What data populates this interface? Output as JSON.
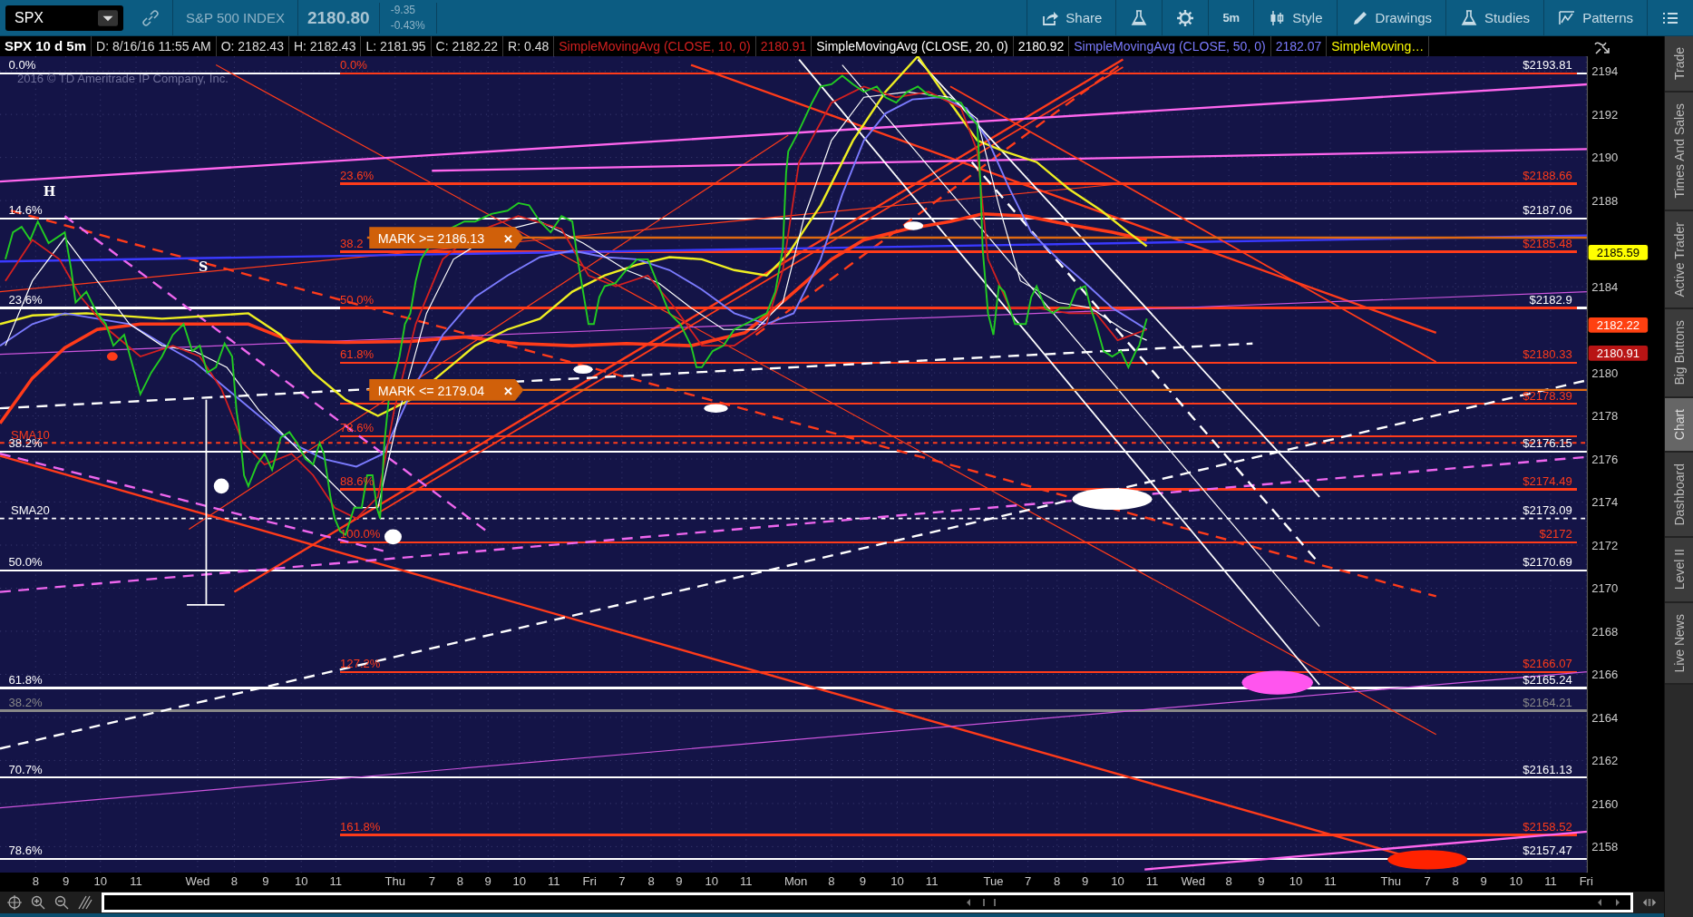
{
  "toolbar": {
    "symbol": "SPX",
    "description": "S&P 500 INDEX",
    "last": "2180.80",
    "change": "-9.35",
    "change_percent": "-0.43%",
    "buttons": [
      {
        "kind": "share",
        "label": "Share"
      },
      {
        "kind": "flask"
      },
      {
        "kind": "gear"
      },
      {
        "kind": "text",
        "label": "5m"
      },
      {
        "kind": "candles",
        "label": "Style"
      },
      {
        "kind": "pencil",
        "label": "Drawings"
      },
      {
        "kind": "flask",
        "label": "Studies"
      },
      {
        "kind": "pattern",
        "label": "Patterns"
      },
      {
        "kind": "list"
      }
    ]
  },
  "info_bar": {
    "title": "SPX 10 d 5m",
    "fields": [
      "D: 8/16/16 11:55 AM",
      "O: 2182.43",
      "H: 2182.43",
      "L: 2181.95",
      "C: 2182.22",
      "R: 0.48"
    ],
    "studies": [
      {
        "name": "SimpleMovingAvg (CLOSE, 10, 0)",
        "value": "2180.91"
      },
      {
        "name": "SimpleMovingAvg (CLOSE, 20, 0)",
        "value": "2180.92"
      },
      {
        "name": "SimpleMovingAvg (CLOSE, 50, 0)",
        "value": "2182.07"
      },
      {
        "name": "SimpleMoving…"
      }
    ]
  },
  "chart": {
    "copyright": "2016 © TD Ameritrade IP Company, Inc.",
    "levels": [
      {
        "kind": "retracement",
        "left_label": "0.0%",
        "price_label": "$2193.81",
        "color": "#ffffff"
      },
      {
        "kind": "extension",
        "left_label": "0.0%",
        "color": "#ff3b1a"
      },
      {
        "kind": "extension",
        "left_label": "23.6%",
        "price_label": "$2188.66",
        "color": "#ff3b1a"
      },
      {
        "kind": "retracement",
        "left_label": "14.6%",
        "price_label": "$2187.06",
        "color": "#ffffff"
      },
      {
        "kind": "extension",
        "left_label": "38.2",
        "price_label": "$2185.48",
        "color": "#ff3b1a"
      },
      {
        "kind": "retracement",
        "left_label": "23.6%",
        "price_label": "$2182.9",
        "color": "#ffffff"
      },
      {
        "kind": "extension",
        "left_label": "50.0%",
        "color": "#ff3b1a"
      },
      {
        "kind": "extension",
        "left_label": "61.8%",
        "price_label": "$2180.33",
        "color": "#ff3b1a"
      },
      {
        "kind": "extension",
        "price_label": "$2178.39",
        "color": "#ff3b1a"
      },
      {
        "kind": "extension",
        "left_label": "78.6%",
        "color": "#ff3b1a"
      },
      {
        "kind": "sma",
        "left_label": "SMA10",
        "color": "#ff3b1a"
      },
      {
        "kind": "retracement",
        "left_label": "38.2%",
        "price_label": "$2176.15",
        "color": "#ffffff"
      },
      {
        "kind": "extension",
        "left_label": "88.6%",
        "price_label": "$2174.49",
        "color": "#ff3b1a"
      },
      {
        "kind": "sma",
        "left_label": "SMA20",
        "price_label": "$2173.09",
        "color": "#ffffff"
      },
      {
        "kind": "extension",
        "left_label": "100.0%",
        "price_label": "$2172",
        "color": "#ff3b1a"
      },
      {
        "kind": "retracement",
        "left_label": "50.0%",
        "price_label": "$2170.69",
        "color": "#ffffff"
      },
      {
        "kind": "extension",
        "left_label": "127.2%",
        "price_label": "$2166.07",
        "color": "#ff3b1a"
      },
      {
        "kind": "retracement",
        "left_label": "61.8%",
        "price_label": "$2165.24",
        "color": "#ffffff"
      },
      {
        "kind": "retracement",
        "left_label": "38.2%",
        "price_label": "$2164.21",
        "color": "#888888"
      },
      {
        "kind": "retracement",
        "left_label": "70.7%",
        "price_label": "$2161.13",
        "color": "#ffffff"
      },
      {
        "kind": "extension",
        "left_label": "161.8%",
        "price_label": "$2158.52",
        "color": "#ff3b1a"
      },
      {
        "kind": "retracement",
        "left_label": "78.6%",
        "price_label": "$2157.47",
        "color": "#ffffff"
      }
    ],
    "marks": [
      {
        "label": "MARK >= 2186.13",
        "close": "✕"
      },
      {
        "label": "MARK <= 2179.04",
        "close": "✕"
      }
    ],
    "annotations": [
      "H",
      "S"
    ],
    "price_axis": [
      "2194",
      "2192",
      "2190",
      "2188",
      "2184",
      "2180",
      "2178",
      "2176",
      "2174",
      "2172",
      "2170",
      "2168",
      "2166",
      "2164",
      "2162",
      "2160",
      "2158"
    ],
    "price_tags": [
      {
        "value": "2185.59",
        "color": "#ffff00"
      },
      {
        "value": "2182.22",
        "color": "#ff4010"
      },
      {
        "value": "2180.91",
        "color": "#b81414"
      }
    ],
    "time_axis": [
      "8",
      "9",
      "10",
      "11",
      "Wed",
      "8",
      "9",
      "10",
      "11",
      "Thu",
      "7",
      "8",
      "9",
      "10",
      "11",
      "Fri",
      "7",
      "8",
      "9",
      "10",
      "11",
      "Mon",
      "8",
      "9",
      "10",
      "11",
      "Tue",
      "7",
      "8",
      "9",
      "10",
      "11",
      "Wed",
      "8",
      "9",
      "10",
      "11",
      "Thu",
      "7",
      "8",
      "9",
      "10",
      "11",
      "Fri"
    ]
  },
  "side_tabs": [
    {
      "label": "Trade",
      "selected": false
    },
    {
      "label": "Times And Sales",
      "selected": false
    },
    {
      "label": "Active Trader",
      "selected": false
    },
    {
      "label": "Big Buttons",
      "selected": false
    },
    {
      "label": "Chart",
      "selected": true
    },
    {
      "label": "Dashboard",
      "selected": false
    },
    {
      "label": "Level II",
      "selected": false
    },
    {
      "label": "Live News",
      "selected": false
    }
  ]
}
